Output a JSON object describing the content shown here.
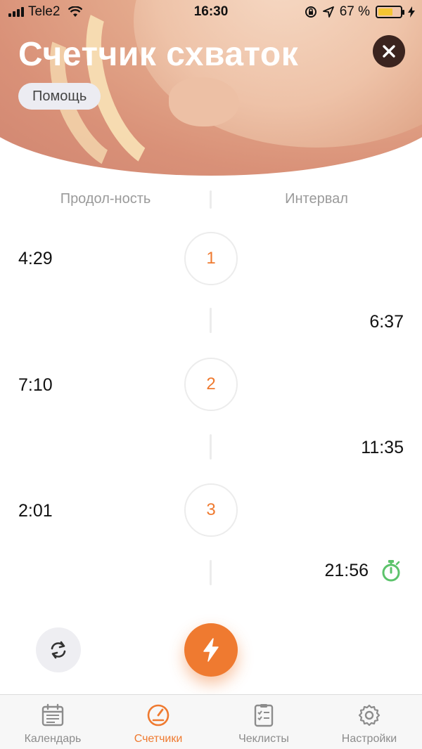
{
  "status_bar": {
    "carrier": "Tele2",
    "time": "16:30",
    "battery_percent": "67 %",
    "battery_level": 0.67
  },
  "header": {
    "title": "Счетчик схваток",
    "help_label": "Помощь",
    "close_icon": "close-icon"
  },
  "columns": {
    "duration_label": "Продол-ность",
    "interval_label": "Интервал"
  },
  "contractions": [
    {
      "number": "1",
      "duration": "4:29",
      "interval": "6:37"
    },
    {
      "number": "2",
      "duration": "7:10",
      "interval": "11:35"
    },
    {
      "number": "3",
      "duration": "2:01",
      "interval": "21:56"
    }
  ],
  "actions": {
    "reset_icon": "refresh-icon",
    "start_icon": "lightning-icon"
  },
  "tabbar": {
    "items": [
      {
        "label": "Календарь",
        "icon": "calendar-icon",
        "active": false
      },
      {
        "label": "Счетчики",
        "icon": "gauge-icon",
        "active": true
      },
      {
        "label": "Чеклисты",
        "icon": "checklist-icon",
        "active": false
      },
      {
        "label": "Настройки",
        "icon": "gear-icon",
        "active": false
      }
    ]
  },
  "colors": {
    "accent": "#ef7a30",
    "timer_green": "#5cc36b",
    "close_bg": "#3b241f"
  }
}
